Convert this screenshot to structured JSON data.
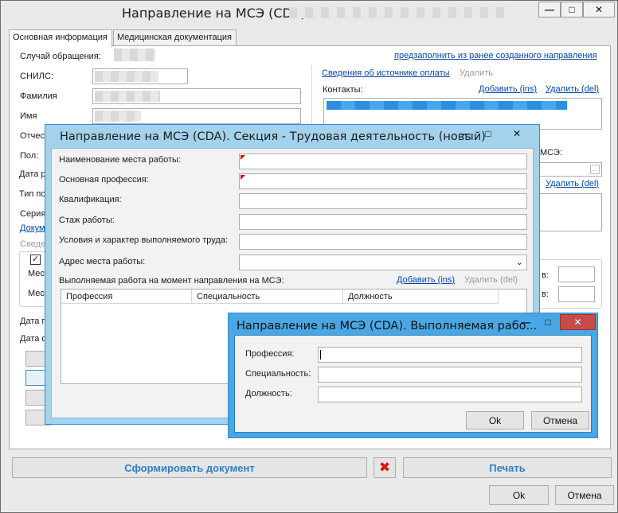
{
  "main": {
    "title": "Направление на МСЭ (CDA) -",
    "tabs": [
      "Основная информация",
      "Медицинская документация"
    ],
    "prefill_link": "предзаполнить из ранее созданного направления",
    "fields": {
      "case_label": "Случай обращения:",
      "snils_label": "СНИЛС:",
      "surname_label": "Фамилия",
      "name_label": "Имя",
      "patronymic_label": "Отчес",
      "sex_label": "Пол:",
      "birth_label": "Дата р",
      "type_label": "Тип по",
      "series_label": "Серия",
      "doc_link": "Докум",
      "info_label": "Сведе",
      "mest1": "Мест",
      "mest2": "Мест",
      "date1": "Дата п",
      "date2": "Дата ф"
    },
    "right": {
      "payment_link": "Сведения об источнике оплаты",
      "payment_delete": "Удалить",
      "contacts_label": "Контакты:",
      "add_link": "Добавить (ins)",
      "delete_link": "Удалить (del)",
      "mse_label": "МСЭ:",
      "delete_link2": "Удалить (del)",
      "v1": "в:",
      "v2": "в:"
    },
    "buttons": {
      "form_doc": "Сформировать документ",
      "print": "Печать",
      "ok": "Ok",
      "cancel": "Отмена"
    },
    "icons": {
      "minimize": "minimize-icon",
      "maximize": "maximize-icon",
      "close": "close-icon",
      "delete_red_x": "delete-x-icon",
      "ellipsis": "ellipsis-icon"
    }
  },
  "section_dialog": {
    "title": "Направление на МСЭ (CDA). Секция - Трудовая деятельность (новый)",
    "workplace_label": "Наименование места работы:",
    "profession_label": "Основная профессия:",
    "qualification_label": "Квалификация:",
    "experience_label": "Стаж работы:",
    "conditions_label": "Условия и характер выполняемого труда:",
    "address_label": "Адрес места работы:",
    "work_label": "Выполняемая работа на момент направления на МСЭ:",
    "add_link": "Добавить (ins)",
    "delete_link": "Удалить (del)",
    "columns": [
      "Профессия",
      "Специальность",
      "Должность"
    ]
  },
  "work_dialog": {
    "title": "Направление на МСЭ (CDA). Выполняемая рабо...",
    "profession_label": "Профессия:",
    "specialty_label": "Специальность:",
    "position_label": "Должность:",
    "ok": "Ok",
    "cancel": "Отмена"
  },
  "colors": {
    "accent_link": "#0645ad",
    "big_button_text": "#2f7fc1",
    "active_window_frame": "#4aa7e3",
    "close_button": "#c84b4b",
    "required_marker": "#d01010"
  }
}
